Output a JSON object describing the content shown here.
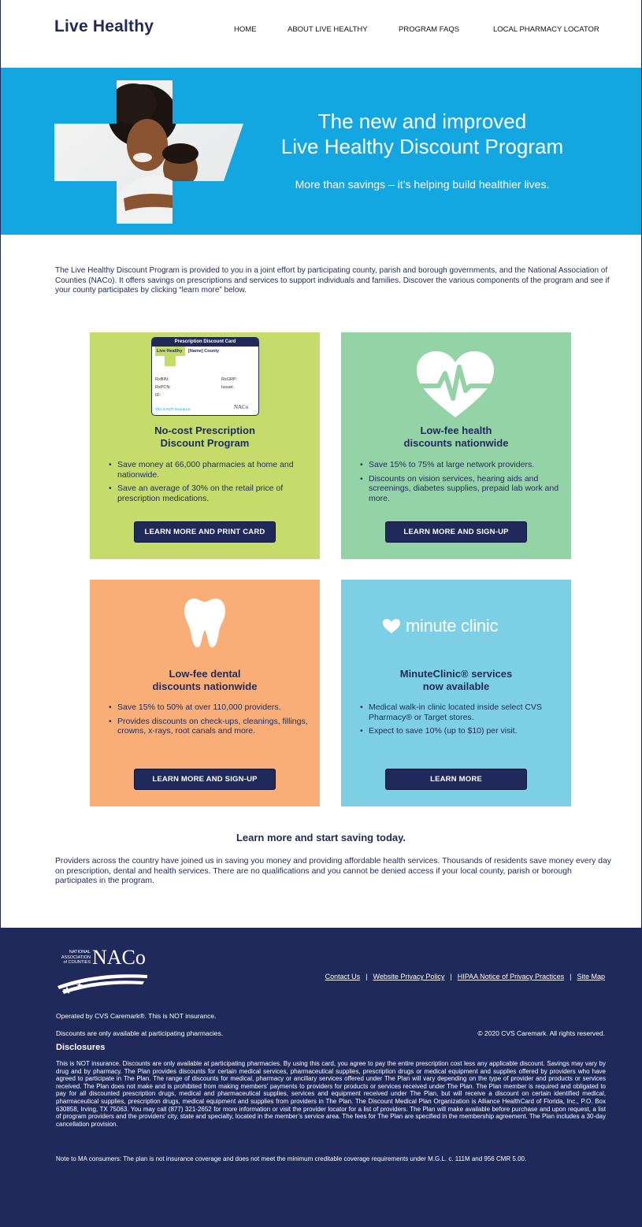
{
  "header": {
    "logo": "Live Healthy",
    "nav": [
      "HOME",
      "ABOUT LIVE HEALTHY",
      "PROGRAM FAQS",
      "LOCAL PHARMACY LOCATOR"
    ]
  },
  "hero": {
    "title_line1": "The new and improved",
    "title_line2": "Live Healthy Discount Program",
    "subtitle": "More than savings – it’s helping build healthier lives.",
    "image_icon": "mother-child-photo"
  },
  "intro": "The Live Healthy Discount Program is provided to you in a joint effort by participating county, parish and borough governments, and the National Association of Counties (NACo). It offers savings on prescriptions and services to support individuals and families. Discover the various components of the program and see if your county participates by clicking “learn more” below.",
  "cards": [
    {
      "icon": "prescription-card-image",
      "rx_card": {
        "header": "Prescription Discount Card",
        "brand": "Live Healthy",
        "county": "[Name] County",
        "fields_left": [
          "RxBIN:",
          "RxPCN:",
          "ID:"
        ],
        "fields_right": [
          "RxGRP:",
          "Issuer:"
        ],
        "note": "This is NOT insurance.",
        "logo": "NACo"
      },
      "heading_line1": "No-cost Prescription",
      "heading_line2": "Discount Program",
      "bullets": [
        "Save money at 66,000 pharmacies at home and nationwide.",
        "Save an average of 30% on the retail price of prescription medications."
      ],
      "button": "LEARN MORE AND PRINT CARD"
    },
    {
      "icon": "heart-pulse-icon",
      "heading_line1": "Low-fee health",
      "heading_line2": "discounts nationwide",
      "bullets": [
        "Save 15% to 75% at large network providers.",
        "Discounts on vision services, hearing aids and screenings, diabetes supplies, prepaid lab work and more."
      ],
      "button": "LEARN MORE AND SIGN-UP"
    },
    {
      "icon": "tooth-icon",
      "heading_line1": "Low-fee dental",
      "heading_line2": "discounts nationwide",
      "bullets": [
        "Save 15% to 50% at over 110,000 providers.",
        "Provides discounts on check-ups, cleanings, fillings, crowns, x-rays, root canals and more."
      ],
      "button": "LEARN MORE AND SIGN-UP"
    },
    {
      "icon": "minute-clinic-logo",
      "logo_text": "minute clinic",
      "heading_line1": "MinuteClinic® services",
      "heading_line2": "now available",
      "bullets": [
        "Medical walk-in clinic located inside select CVS Pharmacy® or Target stores.",
        "Expect to save 10% (up to $10) per visit."
      ],
      "button": "LEARN MORE"
    }
  ],
  "learn": {
    "title": "Learn more and start saving today.",
    "text": "Providers across the country have joined us in saving you money and providing affordable health services. Thousands of residents save money every day on prescription, dental and health services. There are no qualifications and you cannot be denied access if your local county, parish or borough participates in the program."
  },
  "footer": {
    "logo_small": [
      "NATIONAL",
      "ASSOCIATION",
      "of COUNTIES"
    ],
    "logo_big": "NACo",
    "links": [
      "Contact Us",
      "Website Privacy Policy",
      "HIPAA Notice of Privacy Practices",
      "Site Map"
    ],
    "separator": "|",
    "operated": "Operated by CVS Caremark®. This is NOT insurance.",
    "participating": "Discounts are only available at participating pharmacies.",
    "copyright": "© 2020 CVS Caremark. All rights reserved.",
    "disclosures_title": "Disclosures",
    "disclosures_text": "This is NOT insurance. Discounts are only available at participating pharmacies. By using this card, you agree to pay the entire prescription cost less any applicable discount. Savings may vary by drug and by pharmacy. The Plan provides discounts for certain medical services, pharmaceutical supplies, prescription drugs or medical equipment and supplies offered by providers who have agreed to participate in The Plan. The range of discounts for medical, pharmacy or ancillary services offered under The Plan will vary depending on the type of provider and products or services received. The Plan does not make and is prohibited from making members’ payments to providers for products or services received under The Plan. The Plan member is required and obligated to pay for all discounted prescription drugs, medical and pharmaceutical supplies, services and equipment received under The Plan, but will receive a discount on certain identified medical, pharmaceutical supplies, prescription drugs, medical equipment and supplies from providers in The Plan. The Discount Medical Plan Organization is Alliance HealthCard of Florida, Inc., P.O. Box 630858, Irving, TX 75063. You may call (877) 321-2652 for more information or visit the provider locator for a list of providers. The Plan will make available before purchase and upon request, a list of program providers and the providers’ city, state and specialty, located in the member’s service area. The fees for The Plan are specified in the membership agreement. The Plan includes a 30-day cancellation provision.",
    "ma_note": "Note to MA consumers: The plan is not insurance coverage and does not meet the minimum creditable coverage requirements under M.G.L. c. 111M and 956 CMR 5.00."
  },
  "colors": {
    "navy": "#1f2a5a",
    "hero_blue": "#12a7e0",
    "card_green": "#c6dc6a",
    "card_mint": "#93d3a6",
    "card_orange": "#f9ae78",
    "card_cyan": "#7dd0e3"
  }
}
